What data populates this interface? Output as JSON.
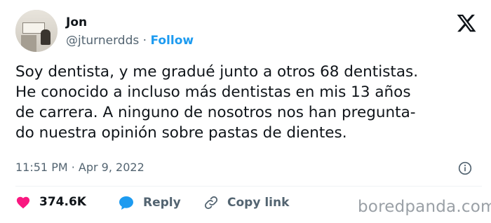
{
  "author": {
    "name": "Jon",
    "handle": "@jturnerdds",
    "separator": " · ",
    "follow_label": "Follow",
    "avatar_icon": "profile-photo"
  },
  "platform_icon": "x-logo-icon",
  "tweet": {
    "lines": [
      "Soy dentista, y me gradué junto a otros 68 dentistas.",
      "He conocido a incluso más dentistas en mis 13 años",
      "de carrera. A ninguno de nosotros nos han pregunta-",
      "do nuestra opinión sobre pastas de dientes."
    ]
  },
  "timestamp": "11:51 PM · Apr 9, 2022",
  "actions": {
    "likes": "374.6K",
    "reply_label": "Reply",
    "copy_link_label": "Copy link"
  },
  "watermark": "boredpanda.com",
  "colors": {
    "text": "#0f1419",
    "muted": "#536471",
    "accent": "#1d9bf0",
    "like": "#f91880",
    "reply": "#1d9bf0"
  }
}
